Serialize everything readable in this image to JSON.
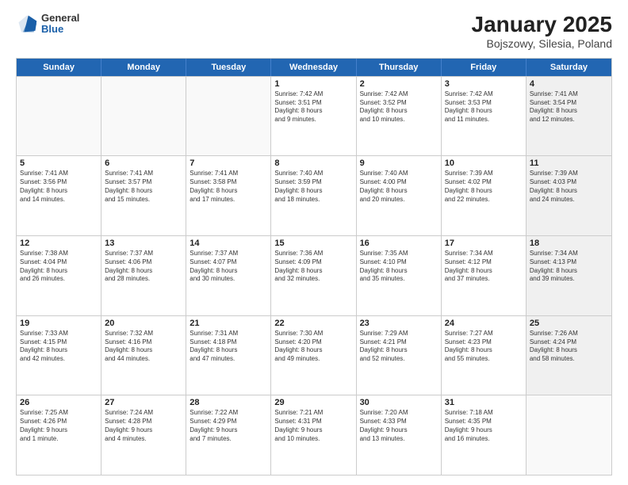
{
  "logo": {
    "general": "General",
    "blue": "Blue"
  },
  "title": "January 2025",
  "subtitle": "Bojszowy, Silesia, Poland",
  "days": [
    "Sunday",
    "Monday",
    "Tuesday",
    "Wednesday",
    "Thursday",
    "Friday",
    "Saturday"
  ],
  "weeks": [
    [
      {
        "day": "",
        "text": "",
        "shaded": false,
        "empty": true
      },
      {
        "day": "",
        "text": "",
        "shaded": false,
        "empty": true
      },
      {
        "day": "",
        "text": "",
        "shaded": false,
        "empty": true
      },
      {
        "day": "1",
        "text": "Sunrise: 7:42 AM\nSunset: 3:51 PM\nDaylight: 8 hours\nand 9 minutes.",
        "shaded": false,
        "empty": false
      },
      {
        "day": "2",
        "text": "Sunrise: 7:42 AM\nSunset: 3:52 PM\nDaylight: 8 hours\nand 10 minutes.",
        "shaded": false,
        "empty": false
      },
      {
        "day": "3",
        "text": "Sunrise: 7:42 AM\nSunset: 3:53 PM\nDaylight: 8 hours\nand 11 minutes.",
        "shaded": false,
        "empty": false
      },
      {
        "day": "4",
        "text": "Sunrise: 7:41 AM\nSunset: 3:54 PM\nDaylight: 8 hours\nand 12 minutes.",
        "shaded": true,
        "empty": false
      }
    ],
    [
      {
        "day": "5",
        "text": "Sunrise: 7:41 AM\nSunset: 3:56 PM\nDaylight: 8 hours\nand 14 minutes.",
        "shaded": false,
        "empty": false
      },
      {
        "day": "6",
        "text": "Sunrise: 7:41 AM\nSunset: 3:57 PM\nDaylight: 8 hours\nand 15 minutes.",
        "shaded": false,
        "empty": false
      },
      {
        "day": "7",
        "text": "Sunrise: 7:41 AM\nSunset: 3:58 PM\nDaylight: 8 hours\nand 17 minutes.",
        "shaded": false,
        "empty": false
      },
      {
        "day": "8",
        "text": "Sunrise: 7:40 AM\nSunset: 3:59 PM\nDaylight: 8 hours\nand 18 minutes.",
        "shaded": false,
        "empty": false
      },
      {
        "day": "9",
        "text": "Sunrise: 7:40 AM\nSunset: 4:00 PM\nDaylight: 8 hours\nand 20 minutes.",
        "shaded": false,
        "empty": false
      },
      {
        "day": "10",
        "text": "Sunrise: 7:39 AM\nSunset: 4:02 PM\nDaylight: 8 hours\nand 22 minutes.",
        "shaded": false,
        "empty": false
      },
      {
        "day": "11",
        "text": "Sunrise: 7:39 AM\nSunset: 4:03 PM\nDaylight: 8 hours\nand 24 minutes.",
        "shaded": true,
        "empty": false
      }
    ],
    [
      {
        "day": "12",
        "text": "Sunrise: 7:38 AM\nSunset: 4:04 PM\nDaylight: 8 hours\nand 26 minutes.",
        "shaded": false,
        "empty": false
      },
      {
        "day": "13",
        "text": "Sunrise: 7:37 AM\nSunset: 4:06 PM\nDaylight: 8 hours\nand 28 minutes.",
        "shaded": false,
        "empty": false
      },
      {
        "day": "14",
        "text": "Sunrise: 7:37 AM\nSunset: 4:07 PM\nDaylight: 8 hours\nand 30 minutes.",
        "shaded": false,
        "empty": false
      },
      {
        "day": "15",
        "text": "Sunrise: 7:36 AM\nSunset: 4:09 PM\nDaylight: 8 hours\nand 32 minutes.",
        "shaded": false,
        "empty": false
      },
      {
        "day": "16",
        "text": "Sunrise: 7:35 AM\nSunset: 4:10 PM\nDaylight: 8 hours\nand 35 minutes.",
        "shaded": false,
        "empty": false
      },
      {
        "day": "17",
        "text": "Sunrise: 7:34 AM\nSunset: 4:12 PM\nDaylight: 8 hours\nand 37 minutes.",
        "shaded": false,
        "empty": false
      },
      {
        "day": "18",
        "text": "Sunrise: 7:34 AM\nSunset: 4:13 PM\nDaylight: 8 hours\nand 39 minutes.",
        "shaded": true,
        "empty": false
      }
    ],
    [
      {
        "day": "19",
        "text": "Sunrise: 7:33 AM\nSunset: 4:15 PM\nDaylight: 8 hours\nand 42 minutes.",
        "shaded": false,
        "empty": false
      },
      {
        "day": "20",
        "text": "Sunrise: 7:32 AM\nSunset: 4:16 PM\nDaylight: 8 hours\nand 44 minutes.",
        "shaded": false,
        "empty": false
      },
      {
        "day": "21",
        "text": "Sunrise: 7:31 AM\nSunset: 4:18 PM\nDaylight: 8 hours\nand 47 minutes.",
        "shaded": false,
        "empty": false
      },
      {
        "day": "22",
        "text": "Sunrise: 7:30 AM\nSunset: 4:20 PM\nDaylight: 8 hours\nand 49 minutes.",
        "shaded": false,
        "empty": false
      },
      {
        "day": "23",
        "text": "Sunrise: 7:29 AM\nSunset: 4:21 PM\nDaylight: 8 hours\nand 52 minutes.",
        "shaded": false,
        "empty": false
      },
      {
        "day": "24",
        "text": "Sunrise: 7:27 AM\nSunset: 4:23 PM\nDaylight: 8 hours\nand 55 minutes.",
        "shaded": false,
        "empty": false
      },
      {
        "day": "25",
        "text": "Sunrise: 7:26 AM\nSunset: 4:24 PM\nDaylight: 8 hours\nand 58 minutes.",
        "shaded": true,
        "empty": false
      }
    ],
    [
      {
        "day": "26",
        "text": "Sunrise: 7:25 AM\nSunset: 4:26 PM\nDaylight: 9 hours\nand 1 minute.",
        "shaded": false,
        "empty": false
      },
      {
        "day": "27",
        "text": "Sunrise: 7:24 AM\nSunset: 4:28 PM\nDaylight: 9 hours\nand 4 minutes.",
        "shaded": false,
        "empty": false
      },
      {
        "day": "28",
        "text": "Sunrise: 7:22 AM\nSunset: 4:29 PM\nDaylight: 9 hours\nand 7 minutes.",
        "shaded": false,
        "empty": false
      },
      {
        "day": "29",
        "text": "Sunrise: 7:21 AM\nSunset: 4:31 PM\nDaylight: 9 hours\nand 10 minutes.",
        "shaded": false,
        "empty": false
      },
      {
        "day": "30",
        "text": "Sunrise: 7:20 AM\nSunset: 4:33 PM\nDaylight: 9 hours\nand 13 minutes.",
        "shaded": false,
        "empty": false
      },
      {
        "day": "31",
        "text": "Sunrise: 7:18 AM\nSunset: 4:35 PM\nDaylight: 9 hours\nand 16 minutes.",
        "shaded": false,
        "empty": false
      },
      {
        "day": "",
        "text": "",
        "shaded": true,
        "empty": true
      }
    ]
  ]
}
